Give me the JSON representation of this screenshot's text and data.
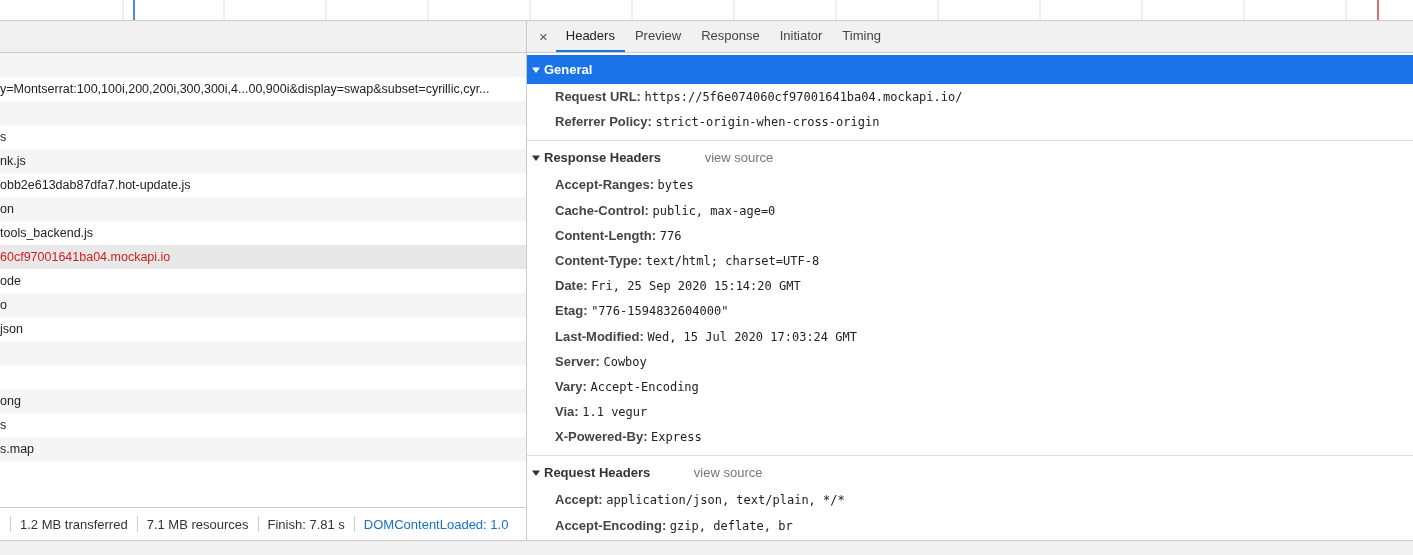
{
  "request_list": {
    "rows": [
      {
        "selected": false
      },
      {
        "name": "y=Montserrat:100,100i,200,200i,300,300i,4...00,900i&display=swap&subset=cyrillic,cyr...",
        "selected": false,
        "error": false
      },
      {
        "selected": false
      },
      {
        "name": "s",
        "selected": false,
        "error": false
      },
      {
        "name": "nk.js",
        "selected": false,
        "error": false
      },
      {
        "name": "obb2e613dab87dfa7.hot-update.js",
        "selected": false,
        "error": false
      },
      {
        "name": "on",
        "selected": false,
        "error": false
      },
      {
        "name": "tools_backend.js",
        "selected": false,
        "error": false
      },
      {
        "name": "60cf97001641ba04.mockapi.io",
        "selected": true,
        "error": true
      },
      {
        "name": "ode",
        "selected": false,
        "error": false
      },
      {
        "name": "o",
        "selected": false,
        "error": false
      },
      {
        "name": "json",
        "selected": false,
        "error": false
      },
      {
        "selected": false
      },
      {
        "selected": false
      },
      {
        "name": "ong",
        "selected": false,
        "error": false
      },
      {
        "name": "s",
        "selected": false,
        "error": false
      },
      {
        "name": "s.map",
        "selected": false,
        "error": false
      }
    ]
  },
  "status_bar": [
    {
      "text": "1.2 MB transferred",
      "kind": "plain"
    },
    {
      "text": "7.1 MB resources",
      "kind": "plain"
    },
    {
      "text": "Finish: 7.81 s",
      "kind": "plain"
    },
    {
      "text": "DOMContentLoaded: 1.0",
      "kind": "link"
    }
  ],
  "details": {
    "close": "×",
    "tabs": [
      {
        "label": "Headers",
        "selected": true
      },
      {
        "label": "Preview",
        "selected": false
      },
      {
        "label": "Response",
        "selected": false
      },
      {
        "label": "Initiator",
        "selected": false
      },
      {
        "label": "Timing",
        "selected": false
      }
    ],
    "sections": [
      {
        "title": "General",
        "expanded": true,
        "selected": true,
        "headers": [
          {
            "name": "Request URL:",
            "value": "https://5f6e074060cf97001641ba04.mockapi.io/"
          },
          {
            "name": "Referrer Policy:",
            "value": "strict-origin-when-cross-origin"
          }
        ]
      },
      {
        "title": "Response Headers",
        "expanded": true,
        "selected": false,
        "link": "view source",
        "headers": [
          {
            "name": "Accept-Ranges:",
            "value": "bytes"
          },
          {
            "name": "Cache-Control:",
            "value": "public, max-age=0"
          },
          {
            "name": "Content-Length:",
            "value": "776"
          },
          {
            "name": "Content-Type:",
            "value": "text/html; charset=UTF-8"
          },
          {
            "name": "Date:",
            "value": "Fri, 25 Sep 2020 15:14:20 GMT"
          },
          {
            "name": "Etag:",
            "value": "\"776-1594832604000\""
          },
          {
            "name": "Last-Modified:",
            "value": "Wed, 15 Jul 2020 17:03:24 GMT"
          },
          {
            "name": "Server:",
            "value": "Cowboy"
          },
          {
            "name": "Vary:",
            "value": "Accept-Encoding"
          },
          {
            "name": "Via:",
            "value": "1.1 vegur"
          },
          {
            "name": "X-Powered-By:",
            "value": "Express"
          }
        ]
      },
      {
        "title": "Request Headers",
        "expanded": true,
        "selected": false,
        "link": "view source",
        "headers": [
          {
            "name": "Accept:",
            "value": "application/json, text/plain, */*"
          },
          {
            "name": "Accept-Encoding:",
            "value": "gzip, deflate, br"
          }
        ]
      }
    ]
  }
}
